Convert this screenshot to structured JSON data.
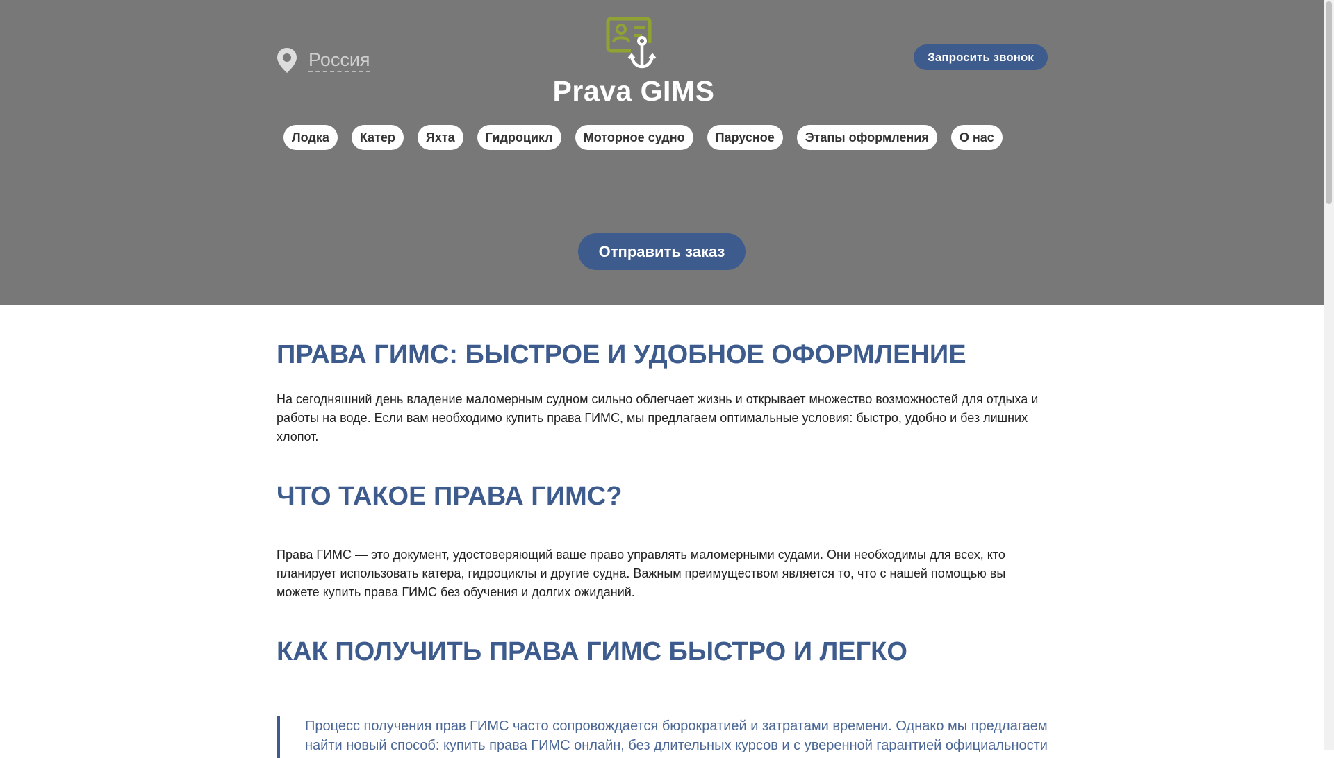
{
  "header": {
    "region": "Россия",
    "site_title": "Prava GIMS",
    "callback_label": "Запросить звонок"
  },
  "nav": {
    "items": [
      {
        "label": "Лодка"
      },
      {
        "label": "Катер"
      },
      {
        "label": "Яхта"
      },
      {
        "label": "Гидроцикл"
      },
      {
        "label": "Моторное судно"
      },
      {
        "label": "Парусное"
      },
      {
        "label": "Этапы оформления"
      },
      {
        "label": "О нас"
      }
    ]
  },
  "hero": {
    "order_label": "Отправить заказ"
  },
  "article": {
    "heading1": "ПРАВА ГИМС: БЫСТРОЕ И УДОБНОЕ ОФОРМЛЕНИЕ",
    "para1": "На сегодняшний день владение маломерным судном сильно облегчает жизнь и открывает множество возможностей для отдыха и работы на воде. Если вам необходимо купить права ГИМС, мы предлагаем оптимальные условия: быстро, удобно и без лишних хлопот.",
    "heading2": "ЧТО ТАКОЕ ПРАВА ГИМС?",
    "para2": "Права ГИМС — это документ, удостоверяющий ваше право управлять маломерными судами. Они необходимы для всех, кто планирует использовать катера, гидроциклы и другие судна. Важным преимуществом является то, что с нашей помощью вы можете купить права ГИМС без обучения и долгих ожиданий.",
    "heading3": "КАК ПОЛУЧИТЬ ПРАВА ГИМС БЫСТРО И ЛЕГКО",
    "quote": "Процесс получения прав ГИМС часто сопровождается бюрократией и затратами времени. Однако мы предлагаем найти новый способ: купить права ГИМС онлайн, без длительных курсов и с уверенной гарантией официальности"
  },
  "icons": {
    "location": "map-pin-icon",
    "logo": "license-anchor-logo-icon"
  },
  "colors": {
    "hero_bg": "#787878",
    "accent": "#3d5b8c",
    "logo_green": "#8fa333"
  }
}
